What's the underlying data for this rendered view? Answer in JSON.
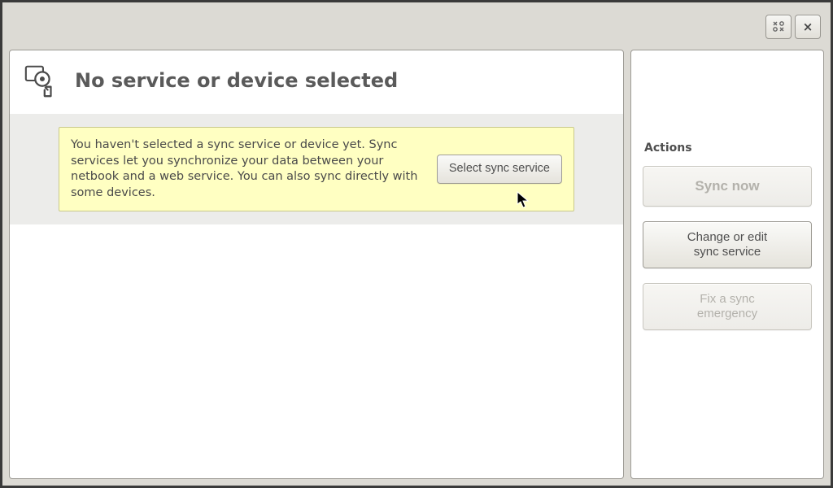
{
  "titlebar": {
    "maximize_glyph": "x o\no x",
    "close_glyph": "×"
  },
  "main": {
    "title": "No service or device selected",
    "notice_text": "You haven't selected a sync service or device yet. Sync services let you synchronize your data between your netbook and a web service. You can also sync directly with some devices.",
    "select_button_label": "Select sync service"
  },
  "sidebar": {
    "actions_heading": "Actions",
    "sync_now_label": "Sync now",
    "change_service_label": "Change or edit\nsync service",
    "fix_emergency_label": "Fix a sync\nemergency"
  }
}
